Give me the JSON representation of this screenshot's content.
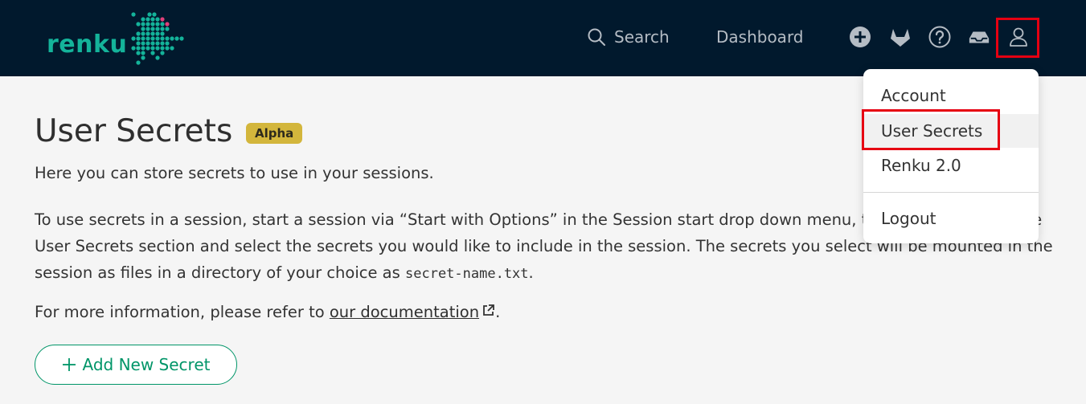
{
  "header": {
    "logo_text": "renku",
    "search_label": "Search",
    "dashboard_label": "Dashboard",
    "icons": [
      "search-icon",
      "plus-circle-icon",
      "gitlab-icon",
      "help-circle-icon",
      "inbox-icon",
      "user-icon"
    ]
  },
  "page": {
    "title": "User Secrets",
    "badge": "Alpha",
    "lead": "Here you can store secrets to use in your sessions.",
    "para_main": "To use secrets in a session, start a session via “Start with Options” in the Session start drop down menu, then scroll down to the User Secrets section and select the secrets you would like to include in the session. The secrets you select will be mounted in the session as files in a directory of your choice as ",
    "para_code": "secret-name.txt",
    "para_end": ".",
    "info_prefix": "For more information, please refer to ",
    "info_link": "our documentation",
    "info_suffix": ".",
    "add_button": "Add New Secret"
  },
  "dropdown": {
    "items": [
      "Account",
      "User Secrets",
      "Renku 2.0"
    ],
    "logout": "Logout",
    "active_item": "User Secrets"
  },
  "colors": {
    "navbar": "#01192d",
    "brand": "#14b39a",
    "accent_green": "#009568",
    "badge": "#d3b63c",
    "highlight": "#e60012"
  }
}
